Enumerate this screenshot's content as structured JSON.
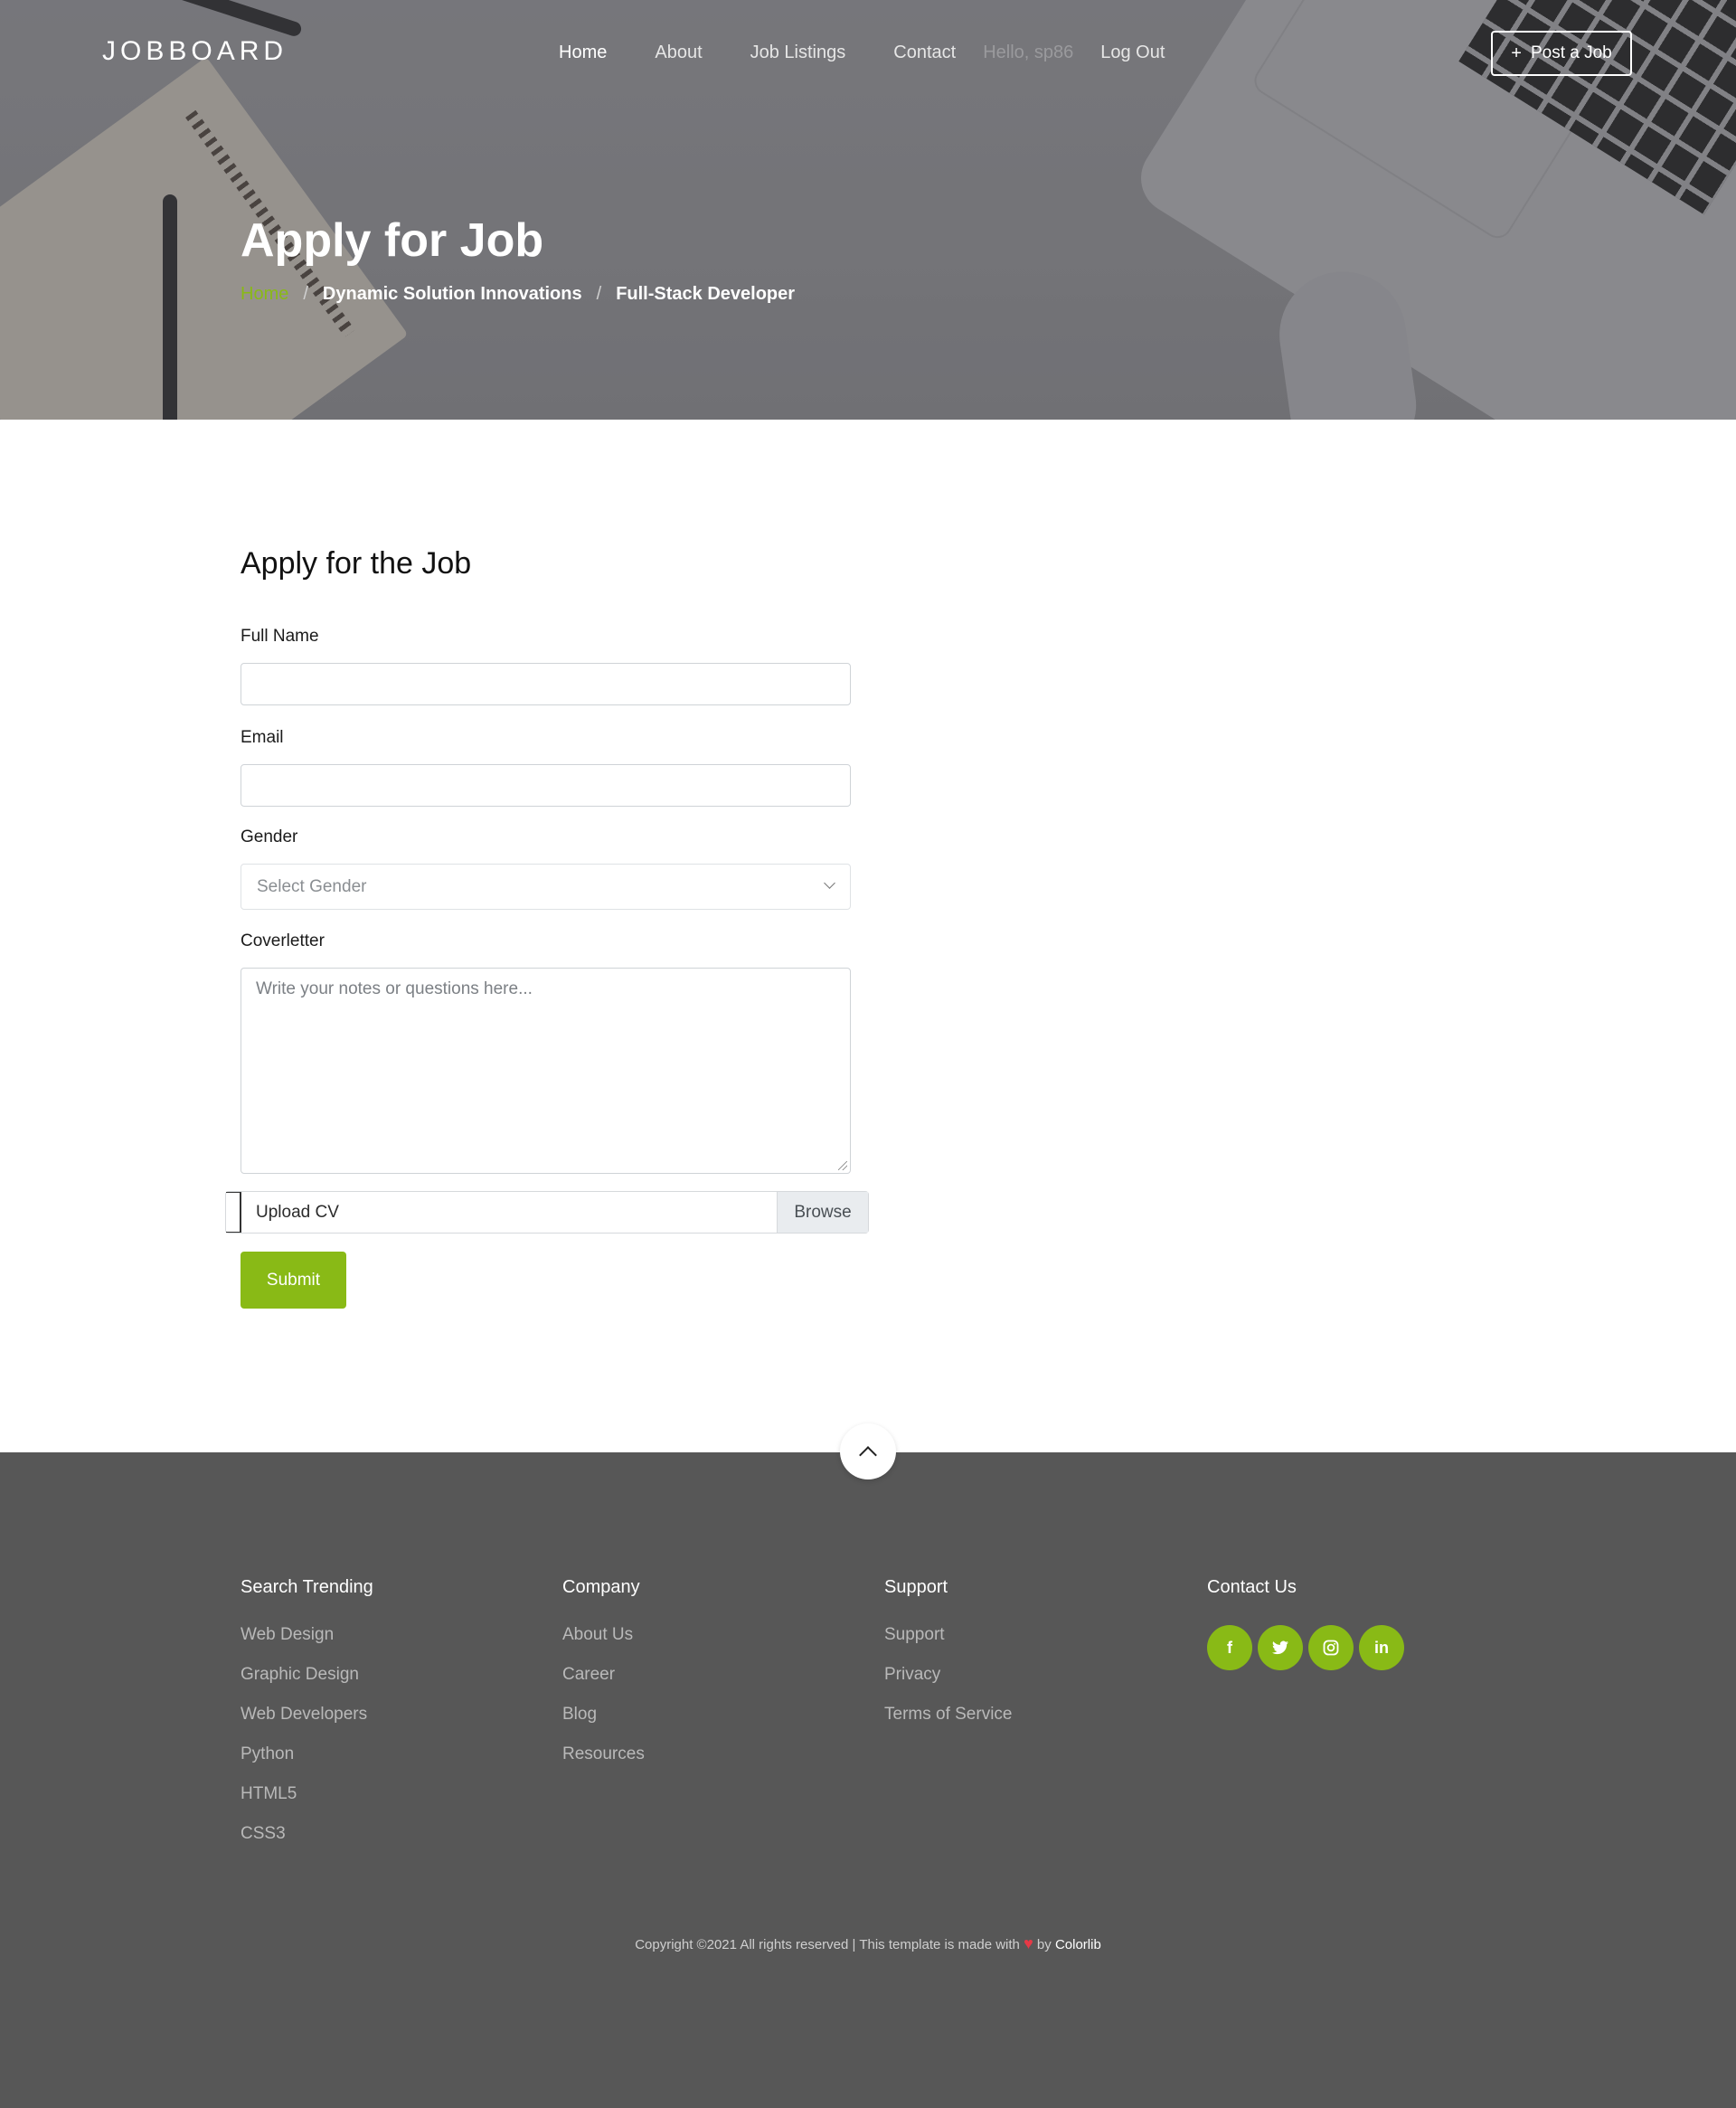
{
  "nav": {
    "brand": "JOBBOARD",
    "items": [
      "Home",
      "About",
      "Job Listings",
      "Contact"
    ],
    "hello": "Hello, sp86",
    "logout": "Log Out",
    "post_job": "Post a Job"
  },
  "hero": {
    "title": "Apply for Job",
    "breadcrumb": [
      "Home",
      "Dynamic Solution Innovations",
      "Full-Stack Developer"
    ]
  },
  "form": {
    "heading": "Apply for the Job",
    "full_name_label": "Full Name",
    "full_name_value": "",
    "email_label": "Email",
    "email_value": "",
    "gender_label": "Gender",
    "gender_placeholder": "Select Gender",
    "coverletter_label": "Coverletter",
    "coverletter_placeholder": "Write your notes or questions here...",
    "upload_label": "Upload CV",
    "browse_label": "Browse",
    "submit_label": "Submit"
  },
  "footer": {
    "columns": [
      {
        "title": "Search Trending",
        "items": [
          "Web Design",
          "Graphic Design",
          "Web Developers",
          "Python",
          "HTML5",
          "CSS3"
        ]
      },
      {
        "title": "Company",
        "items": [
          "About Us",
          "Career",
          "Blog",
          "Resources"
        ]
      },
      {
        "title": "Support",
        "items": [
          "Support",
          "Privacy",
          "Terms of Service"
        ]
      }
    ],
    "contact_title": "Contact Us",
    "socials": [
      "facebook-icon",
      "twitter-icon",
      "instagram-icon",
      "linkedin-icon"
    ],
    "copyright_pre": "Copyright ©2021 All rights reserved | This template is made with",
    "copyright_by": "by",
    "copyright_brand": "Colorlib"
  },
  "colors": {
    "accent": "#89ba16",
    "footer_bg": "#575757"
  }
}
